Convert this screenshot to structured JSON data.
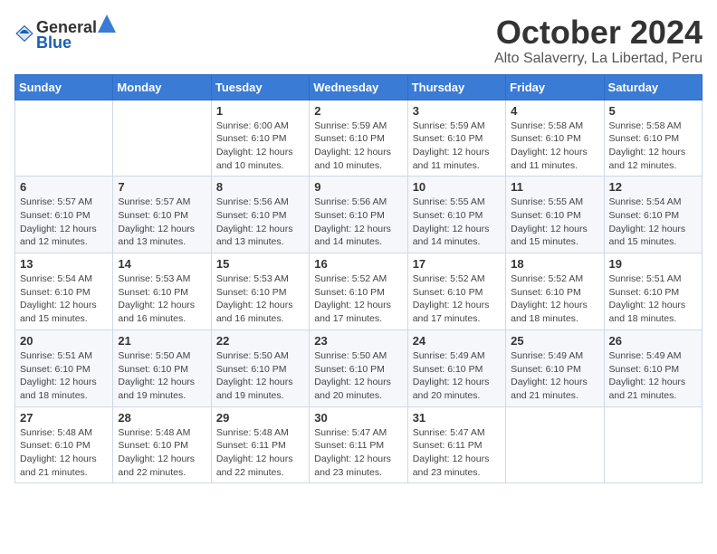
{
  "logo": {
    "general": "General",
    "blue": "Blue"
  },
  "title": "October 2024",
  "subtitle": "Alto Salaverry, La Libertad, Peru",
  "days_of_week": [
    "Sunday",
    "Monday",
    "Tuesday",
    "Wednesday",
    "Thursday",
    "Friday",
    "Saturday"
  ],
  "weeks": [
    [
      {
        "day": "",
        "sunrise": "",
        "sunset": "",
        "daylight": ""
      },
      {
        "day": "",
        "sunrise": "",
        "sunset": "",
        "daylight": ""
      },
      {
        "day": "1",
        "sunrise": "Sunrise: 6:00 AM",
        "sunset": "Sunset: 6:10 PM",
        "daylight": "Daylight: 12 hours and 10 minutes."
      },
      {
        "day": "2",
        "sunrise": "Sunrise: 5:59 AM",
        "sunset": "Sunset: 6:10 PM",
        "daylight": "Daylight: 12 hours and 10 minutes."
      },
      {
        "day": "3",
        "sunrise": "Sunrise: 5:59 AM",
        "sunset": "Sunset: 6:10 PM",
        "daylight": "Daylight: 12 hours and 11 minutes."
      },
      {
        "day": "4",
        "sunrise": "Sunrise: 5:58 AM",
        "sunset": "Sunset: 6:10 PM",
        "daylight": "Daylight: 12 hours and 11 minutes."
      },
      {
        "day": "5",
        "sunrise": "Sunrise: 5:58 AM",
        "sunset": "Sunset: 6:10 PM",
        "daylight": "Daylight: 12 hours and 12 minutes."
      }
    ],
    [
      {
        "day": "6",
        "sunrise": "Sunrise: 5:57 AM",
        "sunset": "Sunset: 6:10 PM",
        "daylight": "Daylight: 12 hours and 12 minutes."
      },
      {
        "day": "7",
        "sunrise": "Sunrise: 5:57 AM",
        "sunset": "Sunset: 6:10 PM",
        "daylight": "Daylight: 12 hours and 13 minutes."
      },
      {
        "day": "8",
        "sunrise": "Sunrise: 5:56 AM",
        "sunset": "Sunset: 6:10 PM",
        "daylight": "Daylight: 12 hours and 13 minutes."
      },
      {
        "day": "9",
        "sunrise": "Sunrise: 5:56 AM",
        "sunset": "Sunset: 6:10 PM",
        "daylight": "Daylight: 12 hours and 14 minutes."
      },
      {
        "day": "10",
        "sunrise": "Sunrise: 5:55 AM",
        "sunset": "Sunset: 6:10 PM",
        "daylight": "Daylight: 12 hours and 14 minutes."
      },
      {
        "day": "11",
        "sunrise": "Sunrise: 5:55 AM",
        "sunset": "Sunset: 6:10 PM",
        "daylight": "Daylight: 12 hours and 15 minutes."
      },
      {
        "day": "12",
        "sunrise": "Sunrise: 5:54 AM",
        "sunset": "Sunset: 6:10 PM",
        "daylight": "Daylight: 12 hours and 15 minutes."
      }
    ],
    [
      {
        "day": "13",
        "sunrise": "Sunrise: 5:54 AM",
        "sunset": "Sunset: 6:10 PM",
        "daylight": "Daylight: 12 hours and 15 minutes."
      },
      {
        "day": "14",
        "sunrise": "Sunrise: 5:53 AM",
        "sunset": "Sunset: 6:10 PM",
        "daylight": "Daylight: 12 hours and 16 minutes."
      },
      {
        "day": "15",
        "sunrise": "Sunrise: 5:53 AM",
        "sunset": "Sunset: 6:10 PM",
        "daylight": "Daylight: 12 hours and 16 minutes."
      },
      {
        "day": "16",
        "sunrise": "Sunrise: 5:52 AM",
        "sunset": "Sunset: 6:10 PM",
        "daylight": "Daylight: 12 hours and 17 minutes."
      },
      {
        "day": "17",
        "sunrise": "Sunrise: 5:52 AM",
        "sunset": "Sunset: 6:10 PM",
        "daylight": "Daylight: 12 hours and 17 minutes."
      },
      {
        "day": "18",
        "sunrise": "Sunrise: 5:52 AM",
        "sunset": "Sunset: 6:10 PM",
        "daylight": "Daylight: 12 hours and 18 minutes."
      },
      {
        "day": "19",
        "sunrise": "Sunrise: 5:51 AM",
        "sunset": "Sunset: 6:10 PM",
        "daylight": "Daylight: 12 hours and 18 minutes."
      }
    ],
    [
      {
        "day": "20",
        "sunrise": "Sunrise: 5:51 AM",
        "sunset": "Sunset: 6:10 PM",
        "daylight": "Daylight: 12 hours and 18 minutes."
      },
      {
        "day": "21",
        "sunrise": "Sunrise: 5:50 AM",
        "sunset": "Sunset: 6:10 PM",
        "daylight": "Daylight: 12 hours and 19 minutes."
      },
      {
        "day": "22",
        "sunrise": "Sunrise: 5:50 AM",
        "sunset": "Sunset: 6:10 PM",
        "daylight": "Daylight: 12 hours and 19 minutes."
      },
      {
        "day": "23",
        "sunrise": "Sunrise: 5:50 AM",
        "sunset": "Sunset: 6:10 PM",
        "daylight": "Daylight: 12 hours and 20 minutes."
      },
      {
        "day": "24",
        "sunrise": "Sunrise: 5:49 AM",
        "sunset": "Sunset: 6:10 PM",
        "daylight": "Daylight: 12 hours and 20 minutes."
      },
      {
        "day": "25",
        "sunrise": "Sunrise: 5:49 AM",
        "sunset": "Sunset: 6:10 PM",
        "daylight": "Daylight: 12 hours and 21 minutes."
      },
      {
        "day": "26",
        "sunrise": "Sunrise: 5:49 AM",
        "sunset": "Sunset: 6:10 PM",
        "daylight": "Daylight: 12 hours and 21 minutes."
      }
    ],
    [
      {
        "day": "27",
        "sunrise": "Sunrise: 5:48 AM",
        "sunset": "Sunset: 6:10 PM",
        "daylight": "Daylight: 12 hours and 21 minutes."
      },
      {
        "day": "28",
        "sunrise": "Sunrise: 5:48 AM",
        "sunset": "Sunset: 6:10 PM",
        "daylight": "Daylight: 12 hours and 22 minutes."
      },
      {
        "day": "29",
        "sunrise": "Sunrise: 5:48 AM",
        "sunset": "Sunset: 6:11 PM",
        "daylight": "Daylight: 12 hours and 22 minutes."
      },
      {
        "day": "30",
        "sunrise": "Sunrise: 5:47 AM",
        "sunset": "Sunset: 6:11 PM",
        "daylight": "Daylight: 12 hours and 23 minutes."
      },
      {
        "day": "31",
        "sunrise": "Sunrise: 5:47 AM",
        "sunset": "Sunset: 6:11 PM",
        "daylight": "Daylight: 12 hours and 23 minutes."
      },
      {
        "day": "",
        "sunrise": "",
        "sunset": "",
        "daylight": ""
      },
      {
        "day": "",
        "sunrise": "",
        "sunset": "",
        "daylight": ""
      }
    ]
  ]
}
